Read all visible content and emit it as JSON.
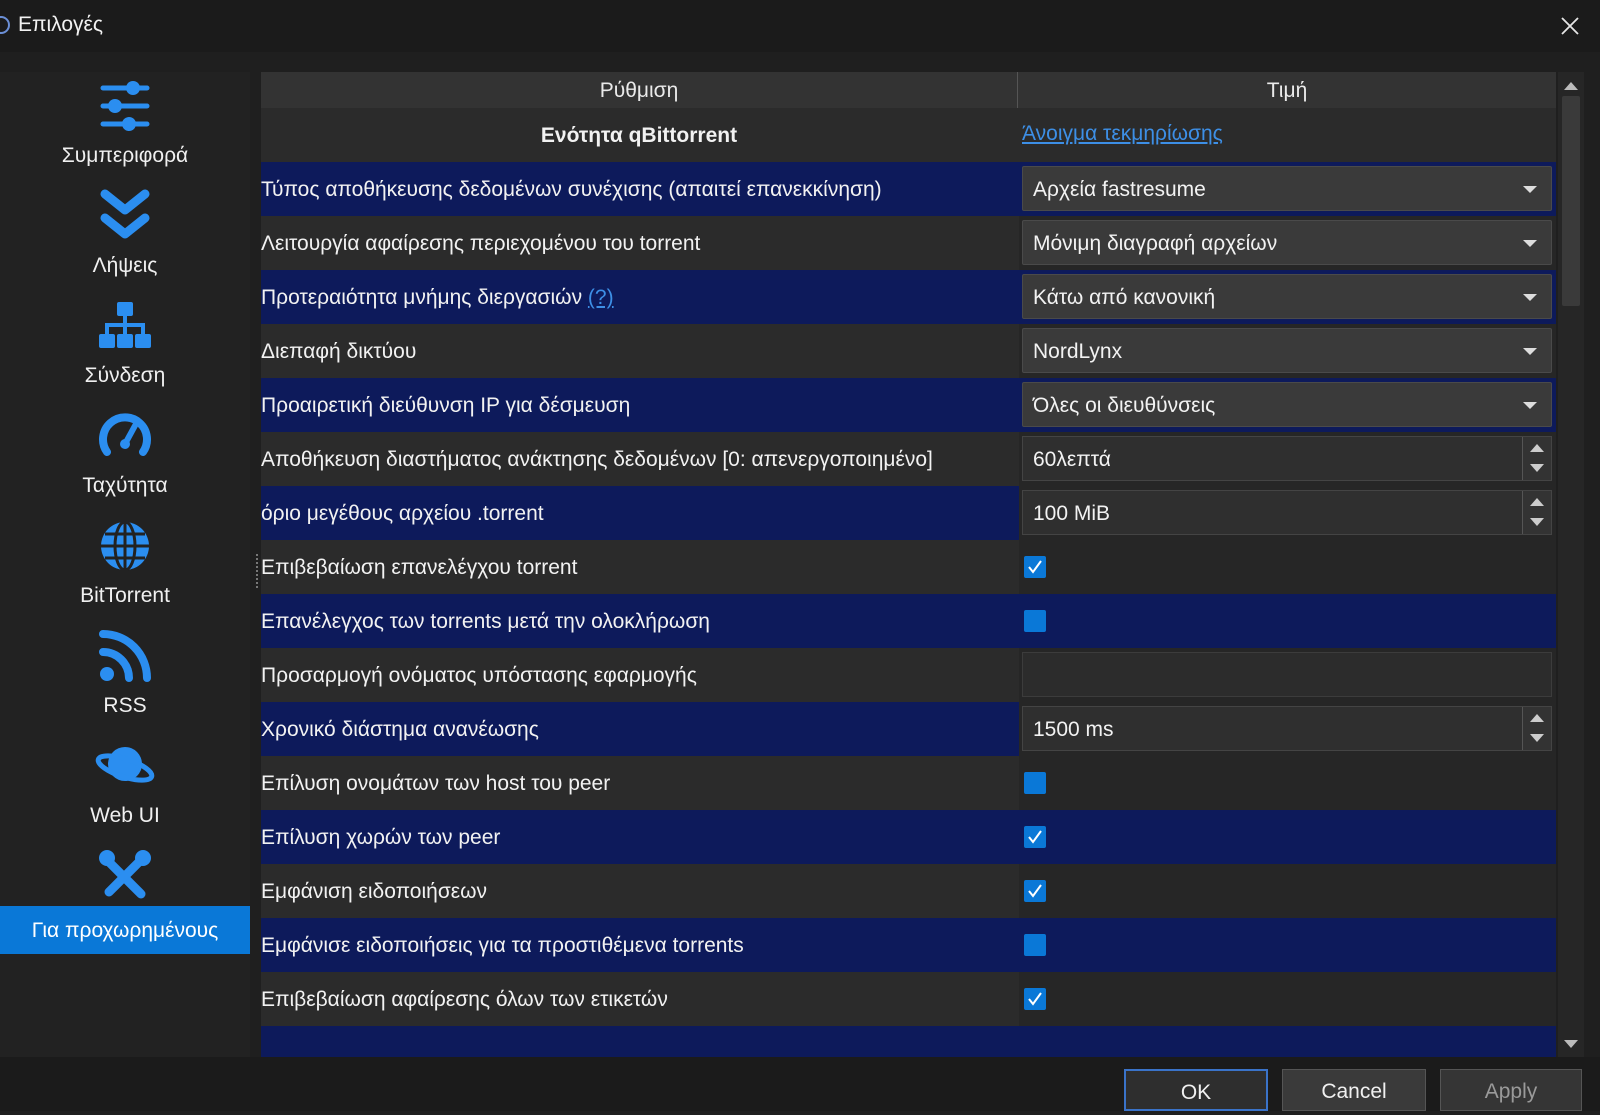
{
  "window": {
    "title": "Επιλογές"
  },
  "sidebar": {
    "items": [
      {
        "label": "Συμπεριφορά",
        "icon": "sliders-icon"
      },
      {
        "label": "Λήψεις",
        "icon": "double-chevron-down-icon"
      },
      {
        "label": "Σύνδεση",
        "icon": "network-tree-icon"
      },
      {
        "label": "Ταχύτητα",
        "icon": "speedometer-icon"
      },
      {
        "label": "BitTorrent",
        "icon": "globe-icon"
      },
      {
        "label": "RSS",
        "icon": "rss-icon"
      },
      {
        "label": "Web UI",
        "icon": "planet-icon"
      },
      {
        "label": "Για προχωρημένους",
        "icon": "tools-icon",
        "active": true
      }
    ]
  },
  "table": {
    "headers": {
      "setting": "Ρύθμιση",
      "value": "Τιμή"
    },
    "section": {
      "label": "Ενότητα qBittorrent",
      "link": "Άνοιγμα τεκμηρίωσης"
    },
    "rows": [
      {
        "setting": "Τύπος αποθήκευσης δεδομένων συνέχισης (απαιτεί επανεκκίνηση)",
        "type": "combo",
        "value": "Αρχεία fastresume"
      },
      {
        "setting": "Λειτουργία αφαίρεσης περιεχομένου του torrent",
        "type": "combo",
        "value": "Μόνιμη διαγραφή αρχείων"
      },
      {
        "setting": "Προτεραιότητα μνήμης διεργασιών",
        "help": "(?)",
        "type": "combo",
        "value": "Κάτω από κανονική"
      },
      {
        "setting": "Διεπαφή δικτύου",
        "type": "combo",
        "value": "NordLynx"
      },
      {
        "setting": "Προαιρετική διεύθυνση IP για δέσμευση",
        "type": "combo",
        "value": "Όλες οι διευθύνσεις"
      },
      {
        "setting": "Αποθήκευση διαστήματος ανάκτησης δεδομένων [0: απενεργοποιημένο]",
        "type": "spin",
        "value": "60λεπτά"
      },
      {
        "setting": "όριο μεγέθους αρχείου .torrent",
        "type": "spin",
        "value": "100 MiB"
      },
      {
        "setting": "Επιβεβαίωση επανελέγχου torrent",
        "type": "check",
        "checked": true
      },
      {
        "setting": "Επανέλεγχος των torrents μετά την ολοκλήρωση",
        "type": "check",
        "checked": false
      },
      {
        "setting": "Προσαρμογή ονόματος υπόστασης εφαρμογής",
        "type": "text",
        "value": ""
      },
      {
        "setting": "Χρονικό διάστημα ανανέωσης",
        "type": "spin",
        "value": "1500 ms"
      },
      {
        "setting": "Επίλυση ονομάτων των host του peer",
        "type": "check",
        "checked": false
      },
      {
        "setting": "Επίλυση χωρών των peer",
        "type": "check",
        "checked": true
      },
      {
        "setting": "Εμφάνιση ειδοποιήσεων",
        "type": "check",
        "checked": true
      },
      {
        "setting": "Εμφάνισε ειδοποιήσεις για τα προστιθέμενα torrents",
        "type": "check",
        "checked": false
      },
      {
        "setting": "Επιβεβαίωση αφαίρεσης όλων των ετικετών",
        "type": "check",
        "checked": true
      }
    ]
  },
  "footer": {
    "ok": "OK",
    "cancel": "Cancel",
    "apply": "Apply"
  },
  "colors": {
    "accent": "#0a78d7",
    "row_highlight": "#0d1a5b",
    "link": "#3d8fe6"
  }
}
